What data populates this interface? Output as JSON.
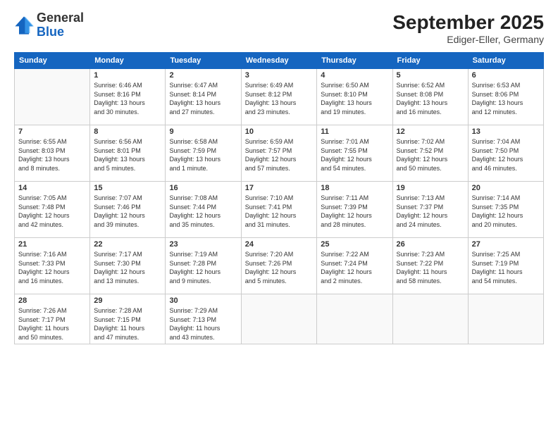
{
  "header": {
    "logo_general": "General",
    "logo_blue": "Blue",
    "month_title": "September 2025",
    "location": "Ediger-Eller, Germany"
  },
  "weekdays": [
    "Sunday",
    "Monday",
    "Tuesday",
    "Wednesday",
    "Thursday",
    "Friday",
    "Saturday"
  ],
  "weeks": [
    [
      {
        "day": "",
        "info": ""
      },
      {
        "day": "1",
        "info": "Sunrise: 6:46 AM\nSunset: 8:16 PM\nDaylight: 13 hours\nand 30 minutes."
      },
      {
        "day": "2",
        "info": "Sunrise: 6:47 AM\nSunset: 8:14 PM\nDaylight: 13 hours\nand 27 minutes."
      },
      {
        "day": "3",
        "info": "Sunrise: 6:49 AM\nSunset: 8:12 PM\nDaylight: 13 hours\nand 23 minutes."
      },
      {
        "day": "4",
        "info": "Sunrise: 6:50 AM\nSunset: 8:10 PM\nDaylight: 13 hours\nand 19 minutes."
      },
      {
        "day": "5",
        "info": "Sunrise: 6:52 AM\nSunset: 8:08 PM\nDaylight: 13 hours\nand 16 minutes."
      },
      {
        "day": "6",
        "info": "Sunrise: 6:53 AM\nSunset: 8:06 PM\nDaylight: 13 hours\nand 12 minutes."
      }
    ],
    [
      {
        "day": "7",
        "info": "Sunrise: 6:55 AM\nSunset: 8:03 PM\nDaylight: 13 hours\nand 8 minutes."
      },
      {
        "day": "8",
        "info": "Sunrise: 6:56 AM\nSunset: 8:01 PM\nDaylight: 13 hours\nand 5 minutes."
      },
      {
        "day": "9",
        "info": "Sunrise: 6:58 AM\nSunset: 7:59 PM\nDaylight: 13 hours\nand 1 minute."
      },
      {
        "day": "10",
        "info": "Sunrise: 6:59 AM\nSunset: 7:57 PM\nDaylight: 12 hours\nand 57 minutes."
      },
      {
        "day": "11",
        "info": "Sunrise: 7:01 AM\nSunset: 7:55 PM\nDaylight: 12 hours\nand 54 minutes."
      },
      {
        "day": "12",
        "info": "Sunrise: 7:02 AM\nSunset: 7:52 PM\nDaylight: 12 hours\nand 50 minutes."
      },
      {
        "day": "13",
        "info": "Sunrise: 7:04 AM\nSunset: 7:50 PM\nDaylight: 12 hours\nand 46 minutes."
      }
    ],
    [
      {
        "day": "14",
        "info": "Sunrise: 7:05 AM\nSunset: 7:48 PM\nDaylight: 12 hours\nand 42 minutes."
      },
      {
        "day": "15",
        "info": "Sunrise: 7:07 AM\nSunset: 7:46 PM\nDaylight: 12 hours\nand 39 minutes."
      },
      {
        "day": "16",
        "info": "Sunrise: 7:08 AM\nSunset: 7:44 PM\nDaylight: 12 hours\nand 35 minutes."
      },
      {
        "day": "17",
        "info": "Sunrise: 7:10 AM\nSunset: 7:41 PM\nDaylight: 12 hours\nand 31 minutes."
      },
      {
        "day": "18",
        "info": "Sunrise: 7:11 AM\nSunset: 7:39 PM\nDaylight: 12 hours\nand 28 minutes."
      },
      {
        "day": "19",
        "info": "Sunrise: 7:13 AM\nSunset: 7:37 PM\nDaylight: 12 hours\nand 24 minutes."
      },
      {
        "day": "20",
        "info": "Sunrise: 7:14 AM\nSunset: 7:35 PM\nDaylight: 12 hours\nand 20 minutes."
      }
    ],
    [
      {
        "day": "21",
        "info": "Sunrise: 7:16 AM\nSunset: 7:33 PM\nDaylight: 12 hours\nand 16 minutes."
      },
      {
        "day": "22",
        "info": "Sunrise: 7:17 AM\nSunset: 7:30 PM\nDaylight: 12 hours\nand 13 minutes."
      },
      {
        "day": "23",
        "info": "Sunrise: 7:19 AM\nSunset: 7:28 PM\nDaylight: 12 hours\nand 9 minutes."
      },
      {
        "day": "24",
        "info": "Sunrise: 7:20 AM\nSunset: 7:26 PM\nDaylight: 12 hours\nand 5 minutes."
      },
      {
        "day": "25",
        "info": "Sunrise: 7:22 AM\nSunset: 7:24 PM\nDaylight: 12 hours\nand 2 minutes."
      },
      {
        "day": "26",
        "info": "Sunrise: 7:23 AM\nSunset: 7:22 PM\nDaylight: 11 hours\nand 58 minutes."
      },
      {
        "day": "27",
        "info": "Sunrise: 7:25 AM\nSunset: 7:19 PM\nDaylight: 11 hours\nand 54 minutes."
      }
    ],
    [
      {
        "day": "28",
        "info": "Sunrise: 7:26 AM\nSunset: 7:17 PM\nDaylight: 11 hours\nand 50 minutes."
      },
      {
        "day": "29",
        "info": "Sunrise: 7:28 AM\nSunset: 7:15 PM\nDaylight: 11 hours\nand 47 minutes."
      },
      {
        "day": "30",
        "info": "Sunrise: 7:29 AM\nSunset: 7:13 PM\nDaylight: 11 hours\nand 43 minutes."
      },
      {
        "day": "",
        "info": ""
      },
      {
        "day": "",
        "info": ""
      },
      {
        "day": "",
        "info": ""
      },
      {
        "day": "",
        "info": ""
      }
    ]
  ]
}
